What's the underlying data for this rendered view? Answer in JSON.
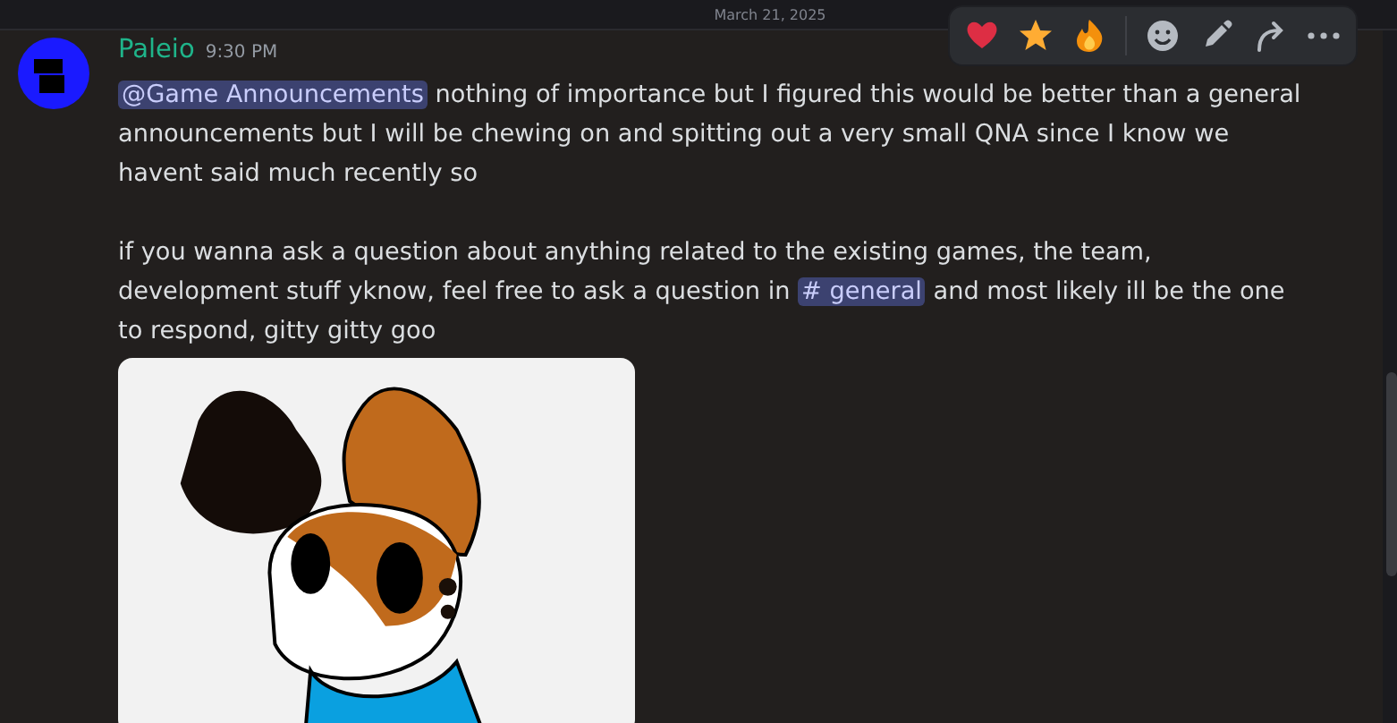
{
  "date_divider": {
    "label": "March 21, 2025"
  },
  "message": {
    "author": "Paleio",
    "time": "9:30 PM",
    "paragraphs": [
      {
        "parts": [
          {
            "kind": "mention",
            "text": "@Game Announcements"
          },
          {
            "kind": "text",
            "text": " nothing of importance but I figured this would be better than a general announcements but I will be chewing on and spitting out a very small QNA since I know we havent said much recently so"
          }
        ]
      },
      {
        "parts": [
          {
            "kind": "text",
            "text": "if you wanna ask a question about anything related to the existing games, the team, development stuff yknow, feel free to ask a question in "
          },
          {
            "kind": "channel",
            "text": "# general"
          },
          {
            "kind": "text",
            "text": " and most likely ill be the one to respond, gitty gitty goo"
          }
        ]
      }
    ]
  },
  "toolbar": [
    {
      "kind": "heart"
    },
    {
      "kind": "star"
    },
    {
      "kind": "fire"
    },
    {
      "kind": "divider"
    },
    {
      "kind": "smile"
    },
    {
      "kind": "pencil"
    },
    {
      "kind": "reply"
    },
    {
      "kind": "more"
    }
  ]
}
